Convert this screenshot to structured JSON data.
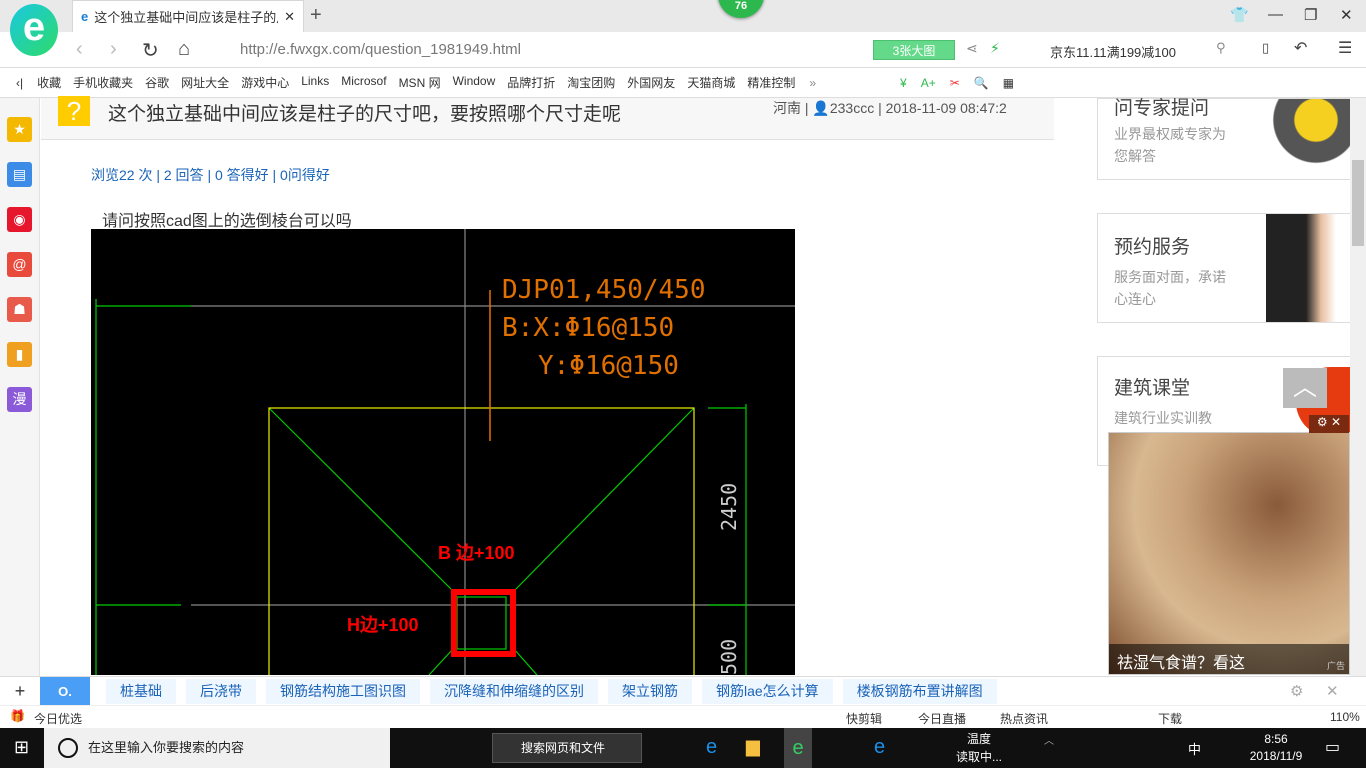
{
  "browser": {
    "tab_title": "这个独立基础中间应该是柱子的尺寸吧，要按照哪个尺寸走呢",
    "badge": "76",
    "url_host": "http://e.fwxgx.com",
    "url_path": "/question_1981949.html",
    "big_image": "3张大图",
    "search_hint": "京东11.11满199减100",
    "logo_letter": "e"
  },
  "bookmarks": [
    "收藏",
    "手机收藏夹",
    "谷歌",
    "网址大全",
    "游戏中心",
    "Links",
    "Microsof",
    "MSN 网",
    "Window",
    "品牌打折",
    "淘宝团购",
    "外国网友",
    "天猫商城",
    "精准控制"
  ],
  "sidebar": [
    {
      "icon": "star-icon",
      "color": "#f5b800",
      "glyph": "★"
    },
    {
      "icon": "news-icon",
      "color": "#3c8ce7",
      "glyph": "▤"
    },
    {
      "icon": "weibo-icon",
      "color": "#e6162d",
      "glyph": "◉"
    },
    {
      "icon": "mail-icon",
      "color": "#e84a3b",
      "glyph": "@"
    },
    {
      "icon": "game-icon",
      "color": "#e85a4a",
      "glyph": "☗"
    },
    {
      "icon": "book-icon",
      "color": "#f0a020",
      "glyph": "▮"
    },
    {
      "icon": "comic-icon",
      "color": "#8a5ad8",
      "glyph": "漫"
    }
  ],
  "question": {
    "title": "这个独立基础中间应该是柱子的尺寸吧，要按照哪个尺寸走呢",
    "region": "河南",
    "user": "233ccc",
    "time": "2018-11-09 08:47:2",
    "stats": "浏览22 次 | 2 回答 | 0 答得好 | 0问得好",
    "body": "请问按照cad图上的选倒棱台可以吗"
  },
  "cad": {
    "line1": "DJP01,450/450",
    "line2": "B:X:Φ16@150",
    "line3": "Y:Φ16@150",
    "dim1": "2450",
    "dim2": "500",
    "note_b": "B  边+100",
    "note_h": "H边+100"
  },
  "right": {
    "card1_title": "问专家提问",
    "card1_desc": "业界最权威专家为您解答",
    "card2_title": "预约服务",
    "card2_desc": "服务面对面，承诺心连心",
    "card3_title": "建筑课堂",
    "card3_desc": "建筑行业实训教",
    "ad_caption": "祛湿气食谱？看这",
    "ad_tag": "广告"
  },
  "hot": [
    "桩基础",
    "后浇带",
    "钢筋结构施工图识图",
    "沉降缝和伸缩缝的区别",
    "架立钢筋",
    "钢筋lae怎么计算",
    "楼板钢筋布置讲解图"
  ],
  "status": {
    "left": "今日优选",
    "items": [
      "快剪辑",
      "今日直播",
      "热点资讯",
      "下载"
    ],
    "zoom": "110%"
  },
  "taskbar": {
    "search_placeholder": "在这里输入你要搜索的内容",
    "web_search": "搜索网页和文件",
    "weather1": "温度",
    "weather2": "读取中...",
    "ime": "中",
    "time": "8:56",
    "date": "2018/11/9"
  }
}
